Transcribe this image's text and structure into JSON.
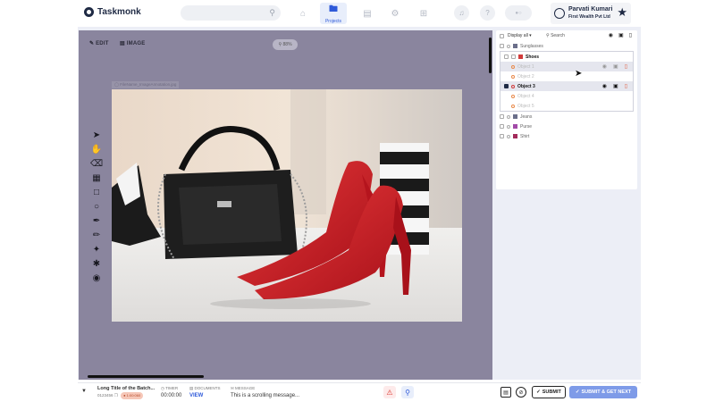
{
  "app": {
    "name": "Taskmonk"
  },
  "header": {
    "nav_active_label": "Projects",
    "user_name": "Parvati Kumari",
    "user_org": "First Wealth Pvt Ltd"
  },
  "canvas": {
    "tab_edit": "EDIT",
    "tab_image": "IMAGE",
    "zoom": "88%",
    "image_filename": "FileName_ImageAnnotation.jpg"
  },
  "panel": {
    "display_filter": "Display all",
    "search_placeholder": "Search",
    "items": [
      {
        "label": "Sunglasses",
        "color": "#6b6f8a",
        "level": 0
      },
      {
        "label": "Shoes",
        "color": "#d13b3b",
        "level": 0
      },
      {
        "label": "Object 1",
        "color": "#e8894a",
        "level": 1
      },
      {
        "label": "Object 2",
        "color": "#e8894a",
        "level": 1
      },
      {
        "label": "Object 3",
        "color": "#d13b3b",
        "level": 1
      },
      {
        "label": "Object 4",
        "color": "#e8894a",
        "level": 1
      },
      {
        "label": "Object 5",
        "color": "#e8894a",
        "level": 1
      },
      {
        "label": "Jeans",
        "color": "#6b6f8a",
        "level": 0
      },
      {
        "label": "Purse",
        "color": "#a24aa8",
        "level": 0
      },
      {
        "label": "Shirt",
        "color": "#a32a5a",
        "level": 0
      }
    ]
  },
  "footer": {
    "batch_title": "Long Title of the Batch...",
    "batch_id": "0123456",
    "pause_badge": "1:00:060",
    "timer_label": "TIMER",
    "timer_value": "00:00:00",
    "documents_label": "DOCUMENTS",
    "documents_link": "VIEW",
    "message_label": "MESSAGE",
    "message_text": "This is a scrolling message...",
    "submit_label": "SUBMIT",
    "submit_next_label": "SUBMIT & GET NEXT"
  }
}
